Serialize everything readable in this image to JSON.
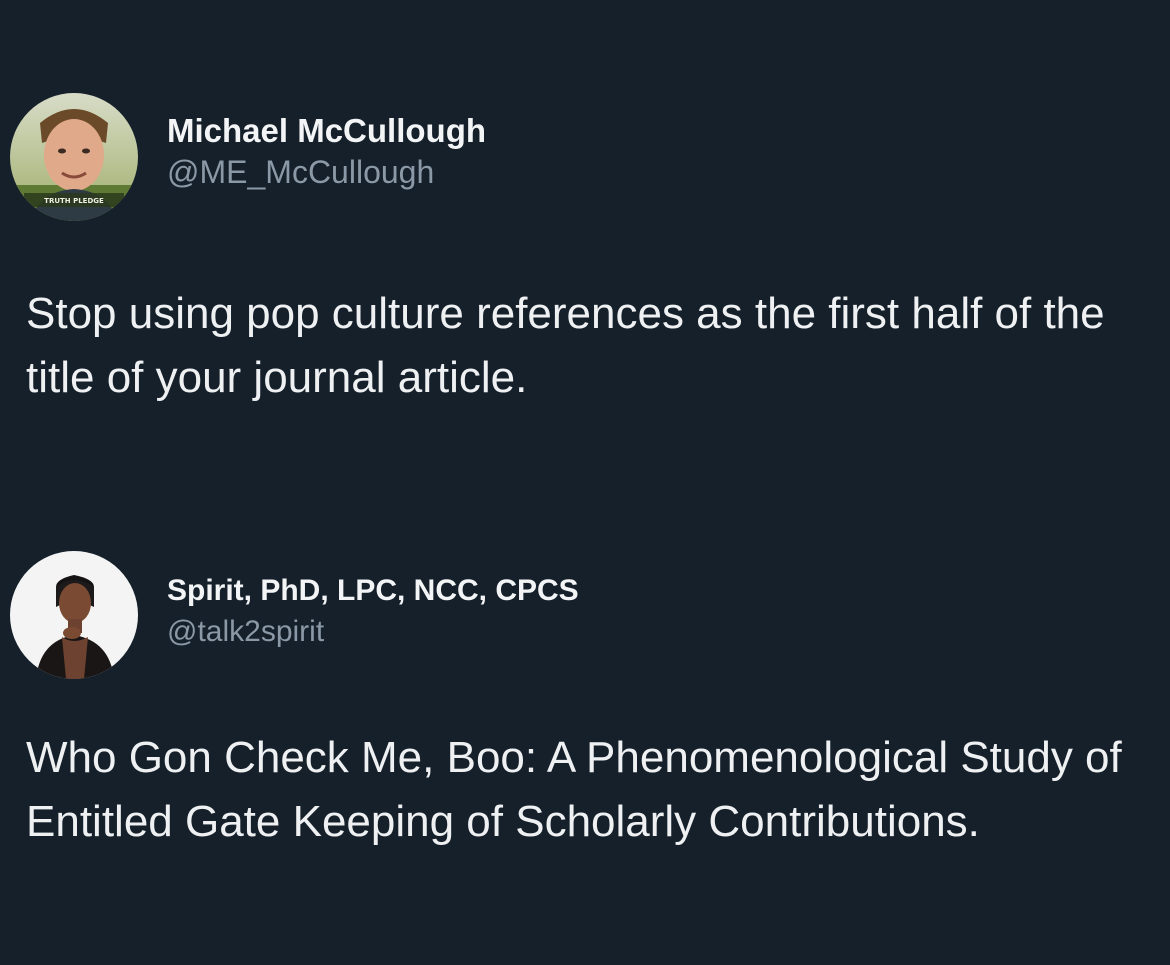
{
  "tweets": [
    {
      "display_name": "Michael McCullough",
      "handle": "@ME_McCullough",
      "avatar_icon": "profile-photo-icon",
      "avatar_caption": "TRUTH PLEDGE",
      "text": "Stop using pop culture references as the first half of the title of your journal article."
    },
    {
      "display_name": "Spirit, PhD, LPC, NCC, CPCS",
      "handle": "@talk2spirit",
      "avatar_icon": "profile-photo-icon",
      "text": "Who Gon Check Me, Boo: A Phenomenological Study of Entitled Gate Keeping of Scholarly Contributions."
    }
  ],
  "colors": {
    "background": "#15202b",
    "primary_text": "#e7e9ea",
    "secondary_text": "#8b98a5"
  }
}
